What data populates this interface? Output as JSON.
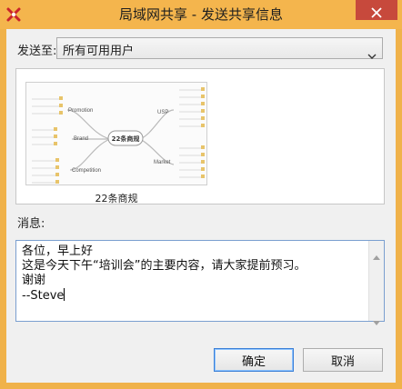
{
  "window": {
    "title": "局域网共享 - 发送共享信息"
  },
  "form": {
    "send_to_label": "发送至:",
    "send_to_value": "所有可用用户",
    "message_label": "消息:"
  },
  "preview": {
    "caption": "22条商规",
    "center_topic": "22条商规",
    "branches": [
      {
        "label": "Promotion",
        "items": [
          "",
          "",
          ""
        ]
      },
      {
        "label": "Brand",
        "items": [
          "",
          "",
          ""
        ]
      },
      {
        "label": "Competition",
        "items": [
          "",
          "",
          "",
          ""
        ]
      },
      {
        "label": "USP",
        "items": [
          "",
          "",
          "",
          "",
          "",
          ""
        ]
      },
      {
        "label": "Market",
        "items": [
          "",
          "",
          "",
          "",
          ""
        ]
      }
    ]
  },
  "message": {
    "lines": [
      "各位，早上好",
      "这是今天下午“培训会”的主要内容，请大家提前预习。",
      "谢谢",
      "--Steve"
    ]
  },
  "buttons": {
    "ok": "确定",
    "cancel": "取消"
  },
  "colors": {
    "frame": "#f4b54d",
    "close": "#c7493c",
    "focus_border": "#3c7fd6"
  },
  "icons": {
    "app": "mindmap-x-icon",
    "close": "close-icon",
    "dropdown": "chevron-down-icon",
    "scroll_up": "scroll-up-arrow-icon",
    "scroll_down": "scroll-down-arrow-icon"
  }
}
